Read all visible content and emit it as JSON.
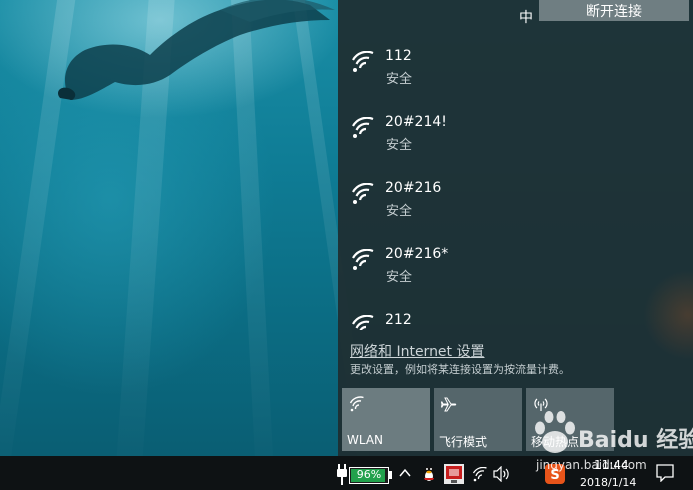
{
  "flyout": {
    "disconnect_label": "断开连接",
    "networks": [
      {
        "ssid": "112",
        "security": "安全"
      },
      {
        "ssid": "20#214!",
        "security": "安全"
      },
      {
        "ssid": "20#216",
        "security": "安全"
      },
      {
        "ssid": "20#216*",
        "security": "安全"
      },
      {
        "ssid": "212",
        "security": ""
      }
    ],
    "settings_link": "网络和 Internet 设置",
    "settings_desc": "更改设置，例如将某连接设置为按流量计费。",
    "tiles": [
      {
        "label": "WLAN",
        "icon": "wifi-icon",
        "active": true
      },
      {
        "label": "飞行模式",
        "icon": "airplane-icon",
        "active": false
      },
      {
        "label": "移动热点",
        "icon": "hotspot-icon",
        "active": false
      }
    ]
  },
  "taskbar": {
    "battery_percent": "96%",
    "battery_level": 0.96,
    "ime": "中",
    "time": "11:44",
    "date": "2018/1/14",
    "icons": [
      "power-plug-icon",
      "chevron-up-icon",
      "qq-penguin-icon",
      "red-app-icon",
      "wifi-icon",
      "speaker-icon",
      "sogou-icon",
      "notification-icon"
    ]
  },
  "watermark": {
    "brand": "Baidu 经验",
    "url": "jingyan.baidu.com"
  },
  "colors": {
    "flyout_bg": "#1f2d30",
    "tile_active": "#6c7c80",
    "tile_inactive": "#55666b",
    "battery_green": "#22a14c",
    "taskbar_bg": "#0e1214"
  }
}
